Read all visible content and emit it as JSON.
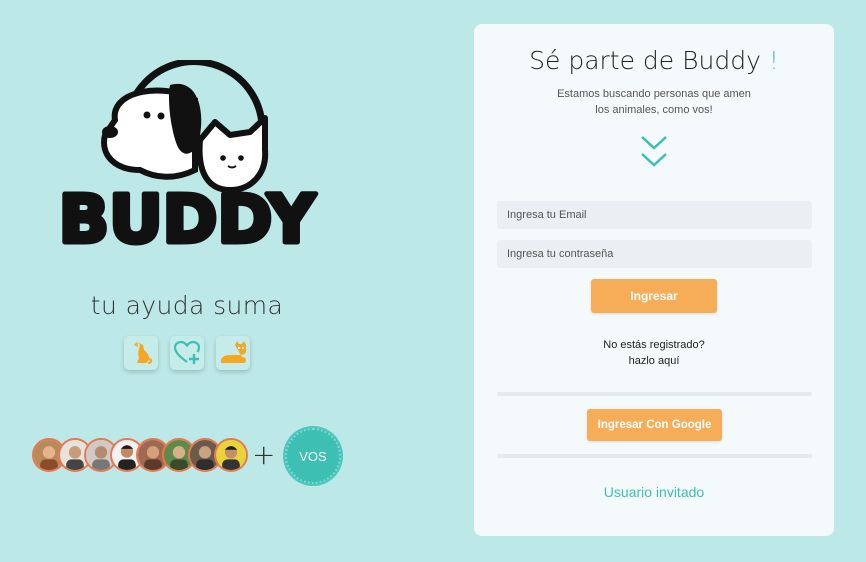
{
  "brand": {
    "logo_icon": "buddy-dog-cat-logo",
    "tagline": "tu ayuda suma",
    "pet_icons": [
      "dog-icon",
      "heart-plus-icon",
      "cat-icon"
    ]
  },
  "community": {
    "avatar_count": 8,
    "plus": "+",
    "vos_label": "VOS"
  },
  "card": {
    "title": "Sé parte de Buddy",
    "title_accent": "!",
    "subtitle_line1": "Estamos buscando personas que amen",
    "subtitle_line2": "los animales, como vos!",
    "email_placeholder": "Ingresa tu Email",
    "password_placeholder": "Ingresa tu contraseña",
    "login_button": "Ingresar",
    "register_line1": "No estás registrado?",
    "register_line2": "hazlo aquí",
    "google_button": "Ingresar Con Google",
    "guest_link": "Usuario invitado"
  },
  "colors": {
    "background": "#bce8e7",
    "accent": "#3dbfb3",
    "button": "#f7ad58",
    "card": "#f4f9fb",
    "icon_orange": "#f5a623",
    "avatar_border": "#e8784f"
  }
}
